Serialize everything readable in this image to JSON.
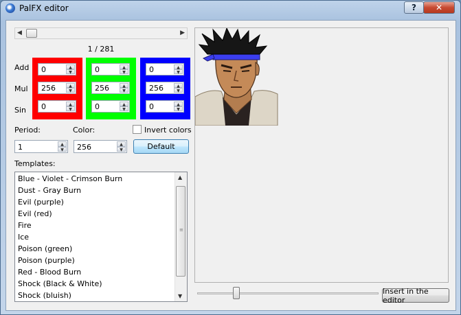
{
  "window": {
    "title": "PalFX editor"
  },
  "titlebar": {
    "help_label": "?",
    "close_label": "✕"
  },
  "frame_scroll": {
    "counter_text": "1 / 281"
  },
  "rows": {
    "add_label": "Add",
    "mul_label": "Mul",
    "sin_label": "Sin"
  },
  "channels": [
    {
      "name": "red",
      "color": "#ff0000",
      "add": "0",
      "mul": "256",
      "sin": "0"
    },
    {
      "name": "green",
      "color": "#00ff00",
      "add": "0",
      "mul": "256",
      "sin": "0"
    },
    {
      "name": "blue",
      "color": "#0000ff",
      "add": "0",
      "mul": "256",
      "sin": "0"
    }
  ],
  "period": {
    "label": "Period:",
    "value": "1"
  },
  "color": {
    "label": "Color:",
    "value": "256"
  },
  "invert": {
    "label": "Invert colors",
    "checked": false
  },
  "default_button": {
    "label": "Default"
  },
  "templates": {
    "label": "Templates:",
    "items": [
      "Blue - Violet - Crimson Burn",
      "Dust - Gray Burn",
      "Evil (purple)",
      "Evil (red)",
      "Fire",
      "Ice",
      "Poison (green)",
      "Poison (purple)",
      "Red - Blood Burn",
      "Shock (Black & White)",
      "Shock (bluish)"
    ]
  },
  "insert_button": {
    "label": "Insert in the editor"
  }
}
